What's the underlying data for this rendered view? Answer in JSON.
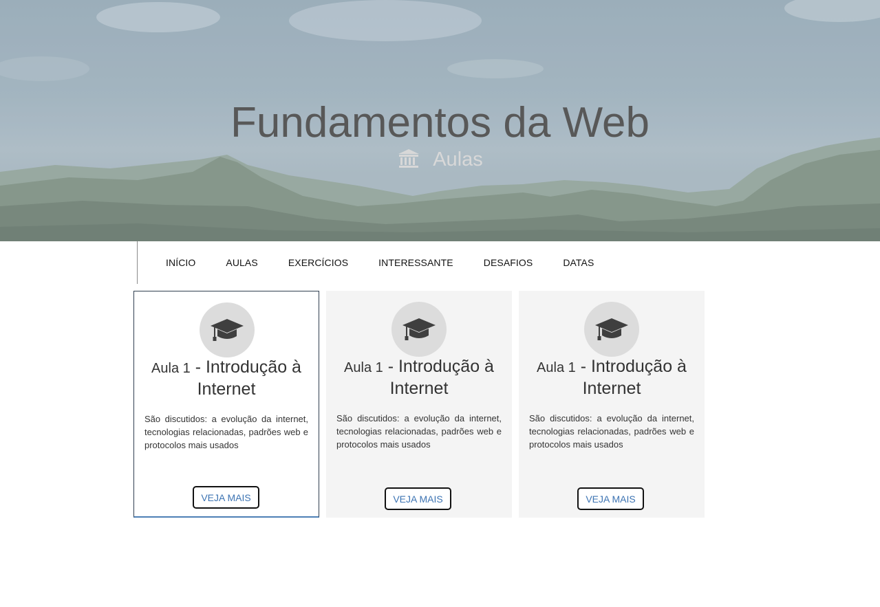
{
  "hero": {
    "title": "Fundamentos da Web",
    "subtitle": "Aulas",
    "subtitle_icon": "bank-icon"
  },
  "nav": {
    "items": [
      {
        "label": "INÍCIO"
      },
      {
        "label": "AULAS"
      },
      {
        "label": "EXERCÍCIOS"
      },
      {
        "label": "INTERESSANTE"
      },
      {
        "label": "DESAFIOS"
      },
      {
        "label": "DATAS"
      }
    ]
  },
  "cards": [
    {
      "icon": "graduation-cap-icon",
      "title_prefix": "Aula 1",
      "title_main": " - Introdução à Internet",
      "description": "São discutidos: a evolução da internet, tecnologias relacionadas, padrões web e protocolos mais usados",
      "button_label": "VEJA MAIS"
    },
    {
      "icon": "graduation-cap-icon",
      "title_prefix": "Aula 1",
      "title_main": " - Introdução à Internet",
      "description": "São discutidos: a evolução da internet, tecnologias relacionadas, padrões web e protocolos mais usados",
      "button_label": "VEJA MAIS"
    },
    {
      "icon": "graduation-cap-icon",
      "title_prefix": "Aula 1",
      "title_main": " - Introdução à Internet",
      "description": "São discutidos: a evolução da internet, tecnologias relacionadas, padrões web e protocolos mais usados",
      "button_label": "VEJA MAIS"
    }
  ],
  "colors": {
    "link_blue": "#3d74b3",
    "card_bg": "#f4f4f4",
    "badge_bg": "#dcdcdc",
    "title_gray": "#585858"
  }
}
